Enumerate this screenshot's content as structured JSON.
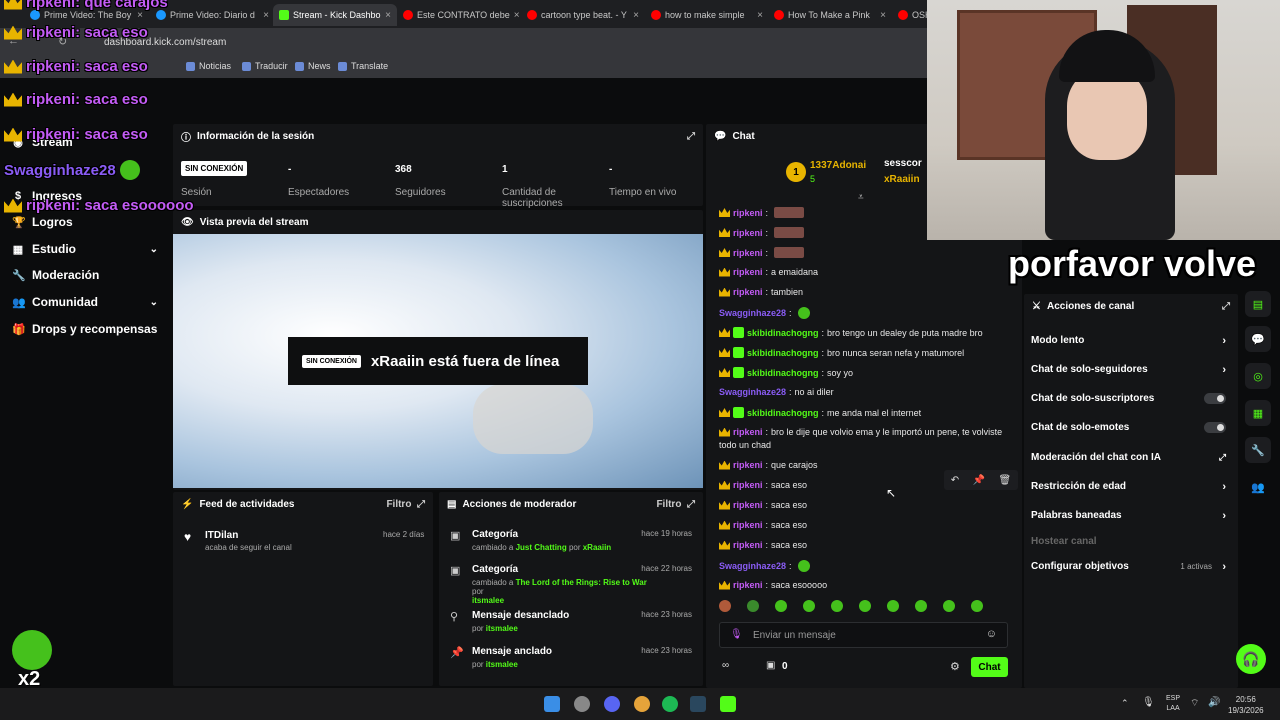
{
  "browser": {
    "tabs": [
      {
        "label": "Prime Video: The Boy",
        "color": "#1a98ff"
      },
      {
        "label": "Prime Video: Diario d",
        "color": "#1a98ff"
      },
      {
        "label": "Stream - Kick Dashbo",
        "color": "#53fc18"
      },
      {
        "label": "Este CONTRATO debe",
        "color": "#ff0000"
      },
      {
        "label": "cartoon type beat. - Y",
        "color": "#ff0000"
      },
      {
        "label": "how to make simple",
        "color": "#ff0000"
      },
      {
        "label": "How To Make a Pink",
        "color": "#ff0000"
      },
      {
        "label": "OSH",
        "color": "#ff0000"
      }
    ],
    "url": "dashboard.kick.com/stream",
    "bookmarks": [
      "Noticias",
      "Traducir",
      "News",
      "Translate"
    ]
  },
  "sidebar": {
    "items": [
      "Stream",
      "Ingresos",
      "Logros",
      "Estudio",
      "Moderación",
      "Comunidad",
      "Drops y recompensas"
    ]
  },
  "session": {
    "title": "Información de la sesión",
    "status_badge": "SIN CONEXIÓN",
    "status_label": "Sesión",
    "stats": [
      {
        "value": "-",
        "label": "Espectadores"
      },
      {
        "value": "368",
        "label": "Seguidores"
      },
      {
        "value": "1",
        "label": "Cantidad de suscripciones"
      },
      {
        "value": "-",
        "label": "Tiempo en vivo"
      }
    ]
  },
  "preview": {
    "title": "Vista previa del stream",
    "badge": "SIN CONEXIÓN",
    "offline_text": "xRaaiin está fuera de línea"
  },
  "feed": {
    "title": "Feed de actividades",
    "filter": "Filtro",
    "items": [
      {
        "user": "ITDilan",
        "text": "acaba de seguir el canal",
        "time": "hace 2 días"
      }
    ]
  },
  "modactions": {
    "title": "Acciones de moderador",
    "filter": "Filtro",
    "items": [
      {
        "title": "Categoría",
        "pre": "cambiado a",
        "target": "Just Chatting",
        "by": "por",
        "user": "xRaaiin",
        "time": "hace 19 horas"
      },
      {
        "title": "Categoría",
        "pre": "cambiado a",
        "target": "The Lord of the Rings: Rise to War",
        "by": "por",
        "user": "itsmalee",
        "time": "hace 22 horas"
      },
      {
        "title": "Mensaje desanclado",
        "pre": "",
        "target": "",
        "by": "por",
        "user": "itsmalee",
        "time": "hace 23 horas"
      },
      {
        "title": "Mensaje anclado",
        "pre": "",
        "target": "",
        "by": "por",
        "user": "itsmalee",
        "time": "hace 23 horas"
      }
    ]
  },
  "chat": {
    "title": "Chat",
    "leaders": [
      {
        "rank": "1",
        "name": "1337Adonai",
        "count": "5"
      },
      {
        "name": "sesscor"
      },
      {
        "name": "xRaaiin"
      }
    ],
    "messages": [
      {
        "user": "ripkeni",
        "text": "",
        "cls": "u1"
      },
      {
        "user": "ripkeni",
        "text": "",
        "cls": "u1"
      },
      {
        "user": "ripkeni",
        "text": "",
        "cls": "u1"
      },
      {
        "user": "ripkeni",
        "text": "a emaidana",
        "cls": "u1"
      },
      {
        "user": "ripkeni",
        "text": "tambien",
        "cls": "u1"
      },
      {
        "user": "Swagginhaze28",
        "text": "",
        "cls": "u3"
      },
      {
        "user": "skibidinachogng",
        "text": "bro tengo un dealey de puta madre bro",
        "cls": "u2"
      },
      {
        "user": "skibidinachogng",
        "text": "bro nunca seran nefa y matumorel",
        "cls": "u2"
      },
      {
        "user": "skibidinachogng",
        "text": "soy yo",
        "cls": "u2"
      },
      {
        "user": "Swagginhaze28",
        "text": "no ai diler",
        "cls": "u3"
      },
      {
        "user": "skibidinachogng",
        "text": "me anda mal el internet",
        "cls": "u2"
      },
      {
        "user": "ripkeni",
        "text": "bro le dije que volvio ema y le importó un pene, te volviste",
        "cls": "u1"
      },
      {
        "user": "",
        "text": "todo un chad",
        "cls": "u1"
      },
      {
        "user": "ripkeni",
        "text": "que carajos",
        "cls": "u1"
      },
      {
        "user": "ripkeni",
        "text": "saca eso",
        "cls": "u1"
      },
      {
        "user": "ripkeni",
        "text": "saca eso",
        "cls": "u1"
      },
      {
        "user": "ripkeni",
        "text": "saca eso",
        "cls": "u1"
      },
      {
        "user": "ripkeni",
        "text": "saca eso",
        "cls": "u1"
      },
      {
        "user": "Swagginhaze28",
        "text": "",
        "cls": "u3"
      },
      {
        "user": "ripkeni",
        "text": "saca esooooo",
        "cls": "u1"
      }
    ],
    "input_placeholder": "Enviar un mensaje",
    "points": "0",
    "send": "Chat"
  },
  "channel_actions": {
    "title": "Acciones de canal",
    "items": [
      {
        "label": "Modo lento",
        "kind": "arrow"
      },
      {
        "label": "Chat de solo-seguidores",
        "kind": "arrow"
      },
      {
        "label": "Chat de solo-suscriptores",
        "kind": "toggle"
      },
      {
        "label": "Chat de solo-emotes",
        "kind": "toggle"
      },
      {
        "label": "Moderación del chat con IA",
        "kind": "ext"
      },
      {
        "label": "Restricción de edad",
        "kind": "arrow"
      },
      {
        "label": "Palabras baneadas",
        "kind": "arrow"
      },
      {
        "label": "Hostear canal",
        "kind": "none"
      },
      {
        "label": "Configurar objetivos",
        "kind": "arrow"
      }
    ],
    "active_goals": "1 activas"
  },
  "overlay": {
    "lines": [
      "ripkeni: que carajos",
      "ripkeni: saca eso",
      "ripkeni: saca eso",
      "ripkeni: saca eso",
      "ripkeni: saca eso",
      "ripkeni: saca esoooooo"
    ],
    "caption": "porfavor volve",
    "multiplier": "x2",
    "swag": "Swagginhaze28"
  },
  "taskbar": {
    "lang": "ESP",
    "region": "LAA",
    "time": "20:56",
    "date": "19/3/2026"
  }
}
